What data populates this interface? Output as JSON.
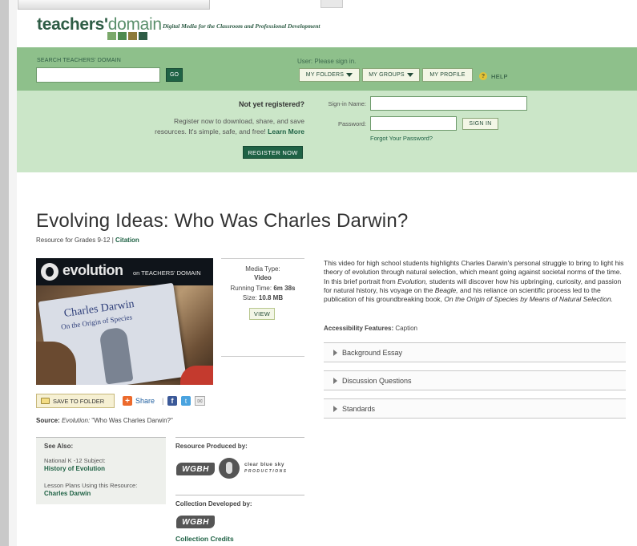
{
  "header": {
    "logo_main": "teachers'",
    "logo_light": "domain",
    "tagline": "Digital Media for the Classroom and Professional Development",
    "logo_colors": [
      "#7aa86a",
      "#4e8a4f",
      "#8c7a3a",
      "#2e5c45"
    ]
  },
  "search": {
    "label": "SEARCH TEACHERS' DOMAIN",
    "value": "",
    "go_label": "GO"
  },
  "user_nav": {
    "status": "User: Please sign in.",
    "my_folders": "MY FOLDERS",
    "my_groups": "MY GROUPS",
    "my_profile": "MY PROFILE",
    "help": "HELP",
    "help_icon": "?"
  },
  "register": {
    "heading": "Not yet registered?",
    "line1": "Register now to download, share, and save",
    "line2": "resources. It's simple, safe, and free!",
    "learn_more": "Learn More",
    "button": "REGISTER NOW"
  },
  "signin": {
    "name_label": "Sign-in Name:",
    "password_label": "Password:",
    "name_value": "",
    "password_value": "",
    "button": "SIGN IN",
    "forgot": "Forgot Your Password?"
  },
  "resource": {
    "title": "Evolving Ideas: Who Was Charles Darwin?",
    "grades": "Resource for Grades 9-12",
    "separator": "|",
    "citation": "Citation"
  },
  "video": {
    "banner_brand": "evolution",
    "banner_suffix": "on TEACHERS' DOMAIN",
    "book_line1": "Charles Darwin",
    "book_line2": "On the Origin of Species"
  },
  "media": {
    "type_label": "Media Type:",
    "type_value": "Video",
    "runtime_label": "Running Time:",
    "runtime_value": "6m 38s",
    "size_label": "Size:",
    "size_value": "10.8 MB",
    "view_button": "VIEW"
  },
  "actions": {
    "save_folder": "SAVE TO FOLDER",
    "share": "Share",
    "separator": "|",
    "share_icon": "+",
    "facebook_icon": "f",
    "twitter_icon": "t",
    "mail_icon": "✉"
  },
  "source": {
    "label": "Source:",
    "program": "Evolution:",
    "episode": "\"Who Was Charles Darwin?\""
  },
  "see_also": {
    "title": "See Also:",
    "items": [
      {
        "label": "National K -12 Subject:",
        "link": "History of Evolution"
      },
      {
        "label": "Lesson Plans Using this Resource:",
        "link": "Charles Darwin"
      }
    ]
  },
  "credits": {
    "produced_title": "Resource Produced by:",
    "wgbh": "WGBH",
    "cbs_line1": "clear blue sky",
    "cbs_line2": "PRODUCTIONS",
    "developed_title": "Collection Developed by:",
    "collection_credits": "Collection Credits"
  },
  "description": {
    "part1": "This video for high school students highlights Charles Darwin's personal struggle to bring to light his theory of evolution through natural selection, which meant going against societal norms of the time. In this brief portrait from ",
    "italic1": "Evolution,",
    "part2": " students will discover how his upbringing, curiosity, and passion for natural history, his voyage on the ",
    "italic2": "Beagle,",
    "part3": " and his reliance on scientific process led to the publication of his groundbreaking book, ",
    "italic3": "On the Origin of Species by Means of Natural Selection.",
    "accessibility_label": "Accessibility Features:",
    "accessibility_value": "Caption"
  },
  "accordion": [
    {
      "label": "Background Essay"
    },
    {
      "label": "Discussion Questions"
    },
    {
      "label": "Standards"
    }
  ]
}
